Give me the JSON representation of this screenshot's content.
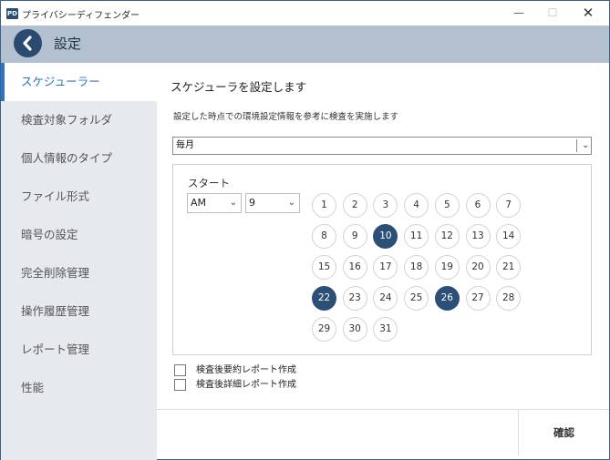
{
  "window": {
    "title": "プライバシーディフェンダー",
    "icon_text": "PD",
    "minimize": "—",
    "maximize": "☐",
    "close": "✕"
  },
  "header": {
    "title": "設定",
    "back_icon": "chevron-left-icon"
  },
  "sidebar": {
    "items": [
      {
        "label": "スケジューラー",
        "active": true
      },
      {
        "label": "検査対象フォルダ",
        "active": false
      },
      {
        "label": "個人情報のタイプ",
        "active": false
      },
      {
        "label": "ファイル形式",
        "active": false
      },
      {
        "label": "暗号の設定",
        "active": false
      },
      {
        "label": "完全削除管理",
        "active": false
      },
      {
        "label": "操作履歴管理",
        "active": false
      },
      {
        "label": "レポート管理",
        "active": false
      },
      {
        "label": "性能",
        "active": false
      }
    ]
  },
  "main": {
    "title": "スケジューラを設定します",
    "description": "設定した時点での環境設定情報を参考に検査を実施します",
    "frequency": "毎月",
    "start_label": "スタート",
    "ampm": "AM",
    "hour": "9",
    "days": [
      "1",
      "2",
      "3",
      "4",
      "5",
      "6",
      "7",
      "8",
      "9",
      "10",
      "11",
      "12",
      "13",
      "14",
      "15",
      "16",
      "17",
      "18",
      "19",
      "20",
      "21",
      "22",
      "23",
      "24",
      "25",
      "26",
      "27",
      "28",
      "29",
      "30",
      "31"
    ],
    "selected_days": [
      "10",
      "22",
      "26"
    ],
    "options": [
      {
        "label": "検査後要約レポート作成",
        "checked": false
      },
      {
        "label": "検査後詳細レポート作成",
        "checked": false
      }
    ],
    "confirm_label": "確認"
  },
  "colors": {
    "accent": "#2d73c7",
    "selected_day": "#2c4f78",
    "header_bg": "#b3c0cf",
    "sidebar_bg": "#e6e9ed"
  }
}
